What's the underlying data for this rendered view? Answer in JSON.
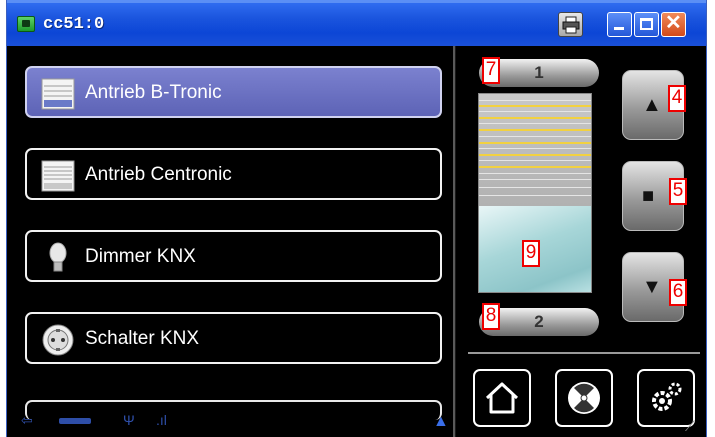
{
  "window": {
    "title": "cc51:0"
  },
  "devices": [
    {
      "label": "Antrieb B-Tronic",
      "icon": "shutter-icon",
      "selected": true
    },
    {
      "label": "Antrieb Centronic",
      "icon": "shutter-icon",
      "selected": false
    },
    {
      "label": "Dimmer KNX",
      "icon": "bulb-icon",
      "selected": false
    },
    {
      "label": "Schalter KNX",
      "icon": "socket-icon",
      "selected": false
    }
  ],
  "shutter_panel": {
    "preset_top": "1",
    "preset_bottom": "2",
    "buttons": [
      "up-icon",
      "stop-icon",
      "down-icon"
    ]
  },
  "bottom_nav": [
    "home-icon",
    "fan-icon",
    "settings-icon"
  ],
  "markers": {
    "up": "4",
    "stop": "5",
    "down": "6",
    "preset_top": "7",
    "preset_bottom": "8",
    "shutter": "9"
  },
  "status": {
    "signal": ".ıl"
  },
  "colors": {
    "titlebar": "#1b55de",
    "selected_item": "#6a70c2",
    "slat": "#f2d140"
  }
}
